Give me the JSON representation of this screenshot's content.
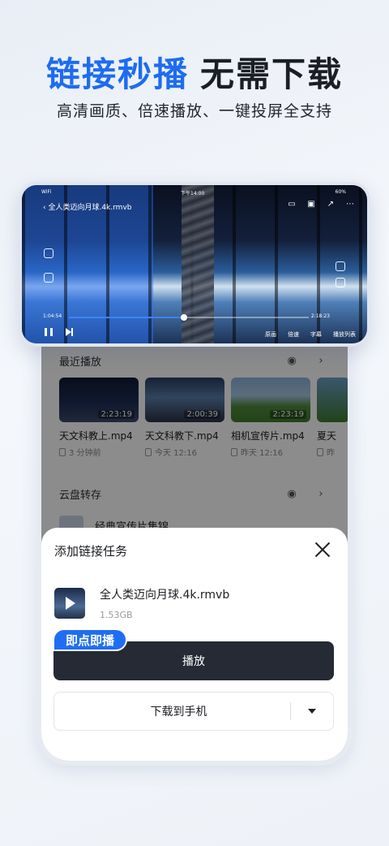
{
  "headline": {
    "highlight": "链接秒播",
    "rest": "无需下载"
  },
  "subheadline": "高清画质、倍速播放、一键投屏全支持",
  "player": {
    "status_left": "WiFi",
    "status_center": "下午14:00",
    "status_right": "60%",
    "video_title": "全人类迈向月球.4k.rmvb",
    "time_elapsed": "1:04:54",
    "time_total": "2:18:23",
    "progress_fraction": 0.48,
    "menu": [
      "原画",
      "倍速",
      "字幕",
      "播放列表"
    ],
    "top_icons": [
      "tv-cast-icon",
      "pip-icon",
      "share-icon",
      "more-icon"
    ]
  },
  "recent": {
    "title": "最近播放",
    "items": [
      {
        "title": "天文科教上.mp4",
        "duration": "2:23:19",
        "meta": "3 分钟前"
      },
      {
        "title": "天文科教下.mp4",
        "duration": "2:00:39",
        "meta": "今天 12:16"
      },
      {
        "title": "相机宣传片.mp4",
        "duration": "2:23:19",
        "meta": "昨天 12:16"
      },
      {
        "title": "夏天",
        "duration": "",
        "meta": "昨"
      }
    ]
  },
  "cloud": {
    "title": "云盘转存",
    "first_item": "经典宣传片集锦"
  },
  "sheet": {
    "title": "添加链接任务",
    "file_name": "全人类迈向月球.4k.rmvb",
    "file_size": "1.53GB",
    "badge": "即点即播",
    "play_label": "播放",
    "download_label": "下载到手机"
  },
  "colors": {
    "accent": "#1f6ef2",
    "button_dark": "#252a35"
  }
}
